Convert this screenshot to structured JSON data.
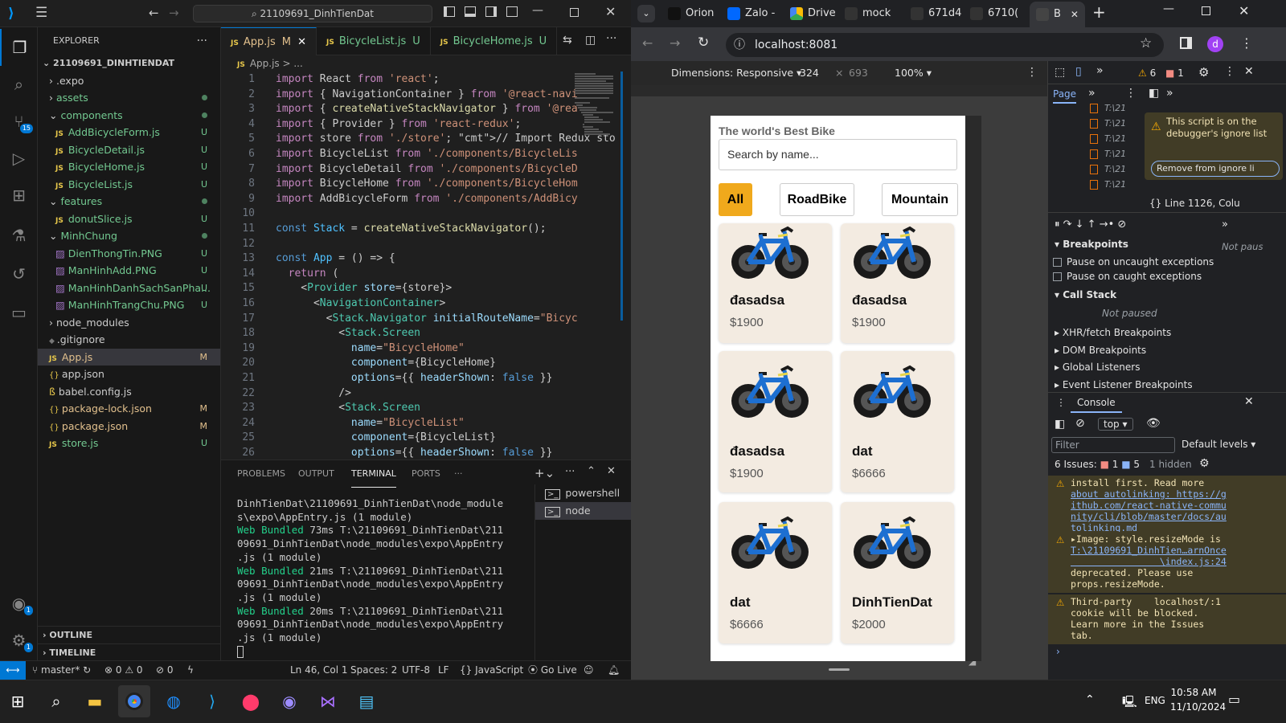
{
  "vscode": {
    "search_text": "21109691_DinhTienDat",
    "explorer_label": "EXPLORER",
    "root_folder": "21109691_DINHTIENDAT",
    "tree": [
      {
        "label": ".expo",
        "kind": "folder",
        "depth": 1,
        "status": ""
      },
      {
        "label": "assets",
        "kind": "folder",
        "depth": 1,
        "status": "dot"
      },
      {
        "label": "components",
        "kind": "folder-open",
        "depth": 1,
        "status": "dot"
      },
      {
        "label": "AddBicycleForm.js",
        "kind": "js",
        "depth": 2,
        "status": "U"
      },
      {
        "label": "BicycleDetail.js",
        "kind": "js",
        "depth": 2,
        "status": "U"
      },
      {
        "label": "BicycleHome.js",
        "kind": "js",
        "depth": 2,
        "status": "U"
      },
      {
        "label": "BicycleList.js",
        "kind": "js",
        "depth": 2,
        "status": "U"
      },
      {
        "label": "features",
        "kind": "folder-open",
        "depth": 1,
        "status": "dot"
      },
      {
        "label": "donutSlice.js",
        "kind": "js",
        "depth": 2,
        "status": "U"
      },
      {
        "label": "MinhChung",
        "kind": "folder-open",
        "depth": 1,
        "status": "dot"
      },
      {
        "label": "DienThongTin.PNG",
        "kind": "img",
        "depth": 2,
        "status": "U"
      },
      {
        "label": "ManHinhAdd.PNG",
        "kind": "img",
        "depth": 2,
        "status": "U"
      },
      {
        "label": "ManHinhDanhSachSanPha...",
        "kind": "img",
        "depth": 2,
        "status": "U"
      },
      {
        "label": "ManHinhTrangChu.PNG",
        "kind": "img",
        "depth": 2,
        "status": "U"
      },
      {
        "label": "node_modules",
        "kind": "folder",
        "depth": 1,
        "status": ""
      },
      {
        "label": ".gitignore",
        "kind": "git",
        "depth": 1,
        "status": ""
      },
      {
        "label": "App.js",
        "kind": "js",
        "depth": 1,
        "status": "M"
      },
      {
        "label": "app.json",
        "kind": "json",
        "depth": 1,
        "status": ""
      },
      {
        "label": "babel.config.js",
        "kind": "babel",
        "depth": 1,
        "status": ""
      },
      {
        "label": "package-lock.json",
        "kind": "json",
        "depth": 1,
        "status": "M"
      },
      {
        "label": "package.json",
        "kind": "json",
        "depth": 1,
        "status": "M"
      },
      {
        "label": "store.js",
        "kind": "js",
        "depth": 1,
        "status": "U"
      }
    ],
    "outline_label": "OUTLINE",
    "timeline_label": "TIMELINE",
    "tabs": [
      {
        "label": "App.js",
        "status": "M",
        "active": true
      },
      {
        "label": "BicycleList.js",
        "status": "U",
        "active": false
      },
      {
        "label": "BicycleHome.js",
        "status": "U",
        "active": false
      }
    ],
    "breadcrumb": "App.js > ...",
    "code_lines": [
      "import React from 'react';",
      "import { NavigationContainer } from '@react-navi",
      "import { createNativeStackNavigator } from '@rea",
      "import { Provider } from 'react-redux';",
      "import store from './store'; // Import Redux sto",
      "import BicycleList from './components/BicycleLis",
      "import BicycleDetail from './components/BicycleD",
      "import BicycleHome from './components/BicycleHom",
      "import AddBicycleForm from './components/AddBicy",
      "",
      "const Stack = createNativeStackNavigator();",
      "",
      "const App = () => {",
      "  return (",
      "    <Provider store={store}>",
      "      <NavigationContainer>",
      "        <Stack.Navigator initialRouteName=\"Bicyc",
      "          <Stack.Screen",
      "            name=\"BicycleHome\"",
      "            component={BicycleHome}",
      "            options={{ headerShown: false }}",
      "          />",
      "          <Stack.Screen",
      "            name=\"BicycleList\"",
      "            component={BicycleList}",
      "            options={{ headerShown: false }}"
    ],
    "panel_tabs": [
      "PROBLEMS",
      "OUTPUT",
      "TERMINAL",
      "PORTS"
    ],
    "terminal_lines": [
      {
        "text": "DinhTienDat\\21109691_DinhTienDat\\node_module",
        "hl": ""
      },
      {
        "text": "s\\expo\\AppEntry.js (1 module)",
        "hl": ""
      },
      {
        "text": "Web Bundled 73ms T:\\21109691_DinhTienDat\\211",
        "hl": "Web Bundled"
      },
      {
        "text": "09691_DinhTienDat\\node_modules\\expo\\AppEntry",
        "hl": ""
      },
      {
        "text": ".js (1 module)",
        "hl": ""
      },
      {
        "text": "Web Bundled 21ms T:\\21109691_DinhTienDat\\211",
        "hl": "Web Bundled"
      },
      {
        "text": "09691_DinhTienDat\\node_modules\\expo\\AppEntry",
        "hl": ""
      },
      {
        "text": ".js (1 module)",
        "hl": ""
      },
      {
        "text": "Web Bundled 20ms T:\\21109691_DinhTienDat\\211",
        "hl": "Web Bundled"
      },
      {
        "text": "09691_DinhTienDat\\node_modules\\expo\\AppEntry",
        "hl": ""
      },
      {
        "text": ".js (1 module)",
        "hl": ""
      }
    ],
    "terminals": [
      "powershell",
      "node"
    ],
    "status": {
      "branch": "master*",
      "errors": "0",
      "warnings": "0",
      "ports": "0",
      "position": "Ln 46, Col 1",
      "spaces": "Spaces: 2",
      "encoding": "UTF-8",
      "eol": "LF",
      "language": "JavaScript",
      "golive": "Go Live"
    },
    "scm_badge": "15",
    "account_badge": "1",
    "settings_badge": "1"
  },
  "chrome": {
    "tabs": [
      "Orion",
      "Zalo -",
      "Drive",
      "mock",
      "671d4",
      "6710(",
      "B"
    ],
    "url": "localhost:8081",
    "profile": "d",
    "dimensions_label": "Dimensions: Responsive",
    "width": "324",
    "height": "693",
    "zoom": "100%"
  },
  "app": {
    "title": "The world's Best Bike",
    "search_placeholder": "Search by name...",
    "categories": [
      {
        "label": "All",
        "active": true
      },
      {
        "label": "RoadBike",
        "active": false
      },
      {
        "label": "Mountain",
        "active": false
      }
    ],
    "products": [
      {
        "name": "đasadsa",
        "price": "$1900"
      },
      {
        "name": "đasadsa",
        "price": "$1900"
      },
      {
        "name": "đasadsa",
        "price": "$1900"
      },
      {
        "name": "dat",
        "price": "$6666"
      },
      {
        "name": "dat",
        "price": "$6666"
      },
      {
        "name": "DinhTienDat",
        "price": "$2000"
      }
    ]
  },
  "devtools": {
    "warnings": "6",
    "errors": "1",
    "page_tab": "Page",
    "ignore_msg": "This script is on the debugger's ignore list",
    "ignore_btn": "Remove from ignore li",
    "line_info": "Line 1126, Colu",
    "not_paused": "Not paus",
    "breakpoints": "Breakpoints",
    "pause_uncaught": "Pause on uncaught exceptions",
    "pause_caught": "Pause on caught exceptions",
    "call_stack": "Call Stack",
    "call_stack_status": "Not paused",
    "sections": [
      "XHR/fetch Breakpoints",
      "DOM Breakpoints",
      "Global Listeners",
      "Event Listener Breakpoints"
    ],
    "console_tab": "Console",
    "context": "top",
    "filter_placeholder": "Filter",
    "levels": "Default levels",
    "issues": "6 Issues:",
    "issues_err": "1",
    "issues_info": "5",
    "hidden": "1 hidden",
    "msg1_lines": [
      "install first. Read more",
      "about autolinking: https://g",
      "ithub.com/react-native-commu",
      "nity/cli/blob/master/docs/au",
      "tolinking.md"
    ],
    "msg2_lines": [
      "▸Image: style.resizeMode is",
      "T:\\21109691_DinhTien…arnOnce",
      "                \\index.js:24",
      "deprecated. Please use",
      "props.resizeMode."
    ],
    "msg3_lines": [
      "Third-party    localhost/:1",
      "cookie will be blocked.",
      "Learn more in the Issues",
      "tab."
    ],
    "file_items": [
      "T:\\21",
      "T:\\21",
      "T:\\21",
      "T:\\21",
      "T:\\21",
      "T:\\21"
    ]
  },
  "taskbar": {
    "lang": "ENG",
    "time": "10:58 AM",
    "date": "11/10/2024"
  }
}
